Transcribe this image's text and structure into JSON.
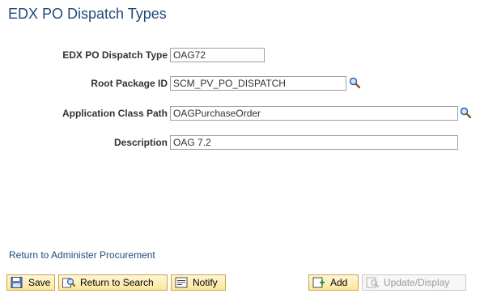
{
  "page": {
    "title": "EDX PO Dispatch Types"
  },
  "fields": {
    "dispatch_type": {
      "label": "EDX PO Dispatch Type",
      "value": "OAG72"
    },
    "root_package_id": {
      "label": "Root Package ID",
      "value": "SCM_PV_PO_DISPATCH"
    },
    "app_class_path": {
      "label": "Application Class Path",
      "value": "OAGPurchaseOrder"
    },
    "description": {
      "label": "Description",
      "value": "OAG 7.2"
    }
  },
  "links": {
    "return": "Return to Administer Procurement"
  },
  "toolbar": {
    "save_label": "Save",
    "return_search_label": "Return to Search",
    "notify_label": "Notify",
    "add_label": "Add",
    "update_display_label": "Update/Display"
  },
  "colors": {
    "title": "#23497a",
    "button_bg": "#ffe69c",
    "button_border": "#c9a34a"
  },
  "icons": {
    "lookup": "magnifier-icon",
    "save": "floppy-disk-icon",
    "return_search": "search-return-icon",
    "notify": "notify-icon",
    "add": "add-icon",
    "update_display": "update-display-icon"
  }
}
